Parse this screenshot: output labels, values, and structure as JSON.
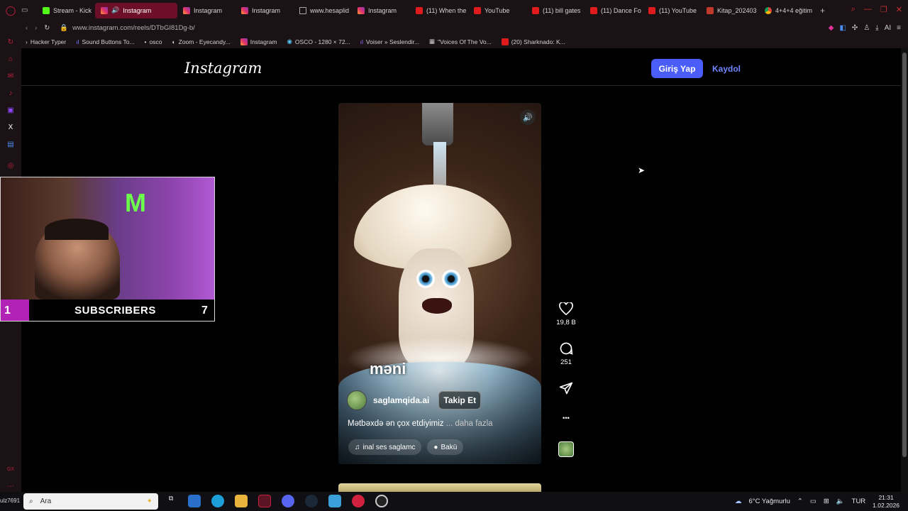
{
  "browser": {
    "tabs": [
      {
        "label": "Stream - Kick",
        "icon": "kick-icon"
      },
      {
        "label": "Instagram",
        "icon": "instagram-icon",
        "active": true
      },
      {
        "label": "Instagram",
        "icon": "instagram-icon"
      },
      {
        "label": "Instagram",
        "icon": "instagram-icon"
      },
      {
        "label": "www.hesaplid",
        "icon": "page-icon"
      },
      {
        "label": "Instagram",
        "icon": "instagram-icon"
      },
      {
        "label": "(11) When the",
        "icon": "youtube-icon"
      },
      {
        "label": "YouTube",
        "icon": "youtube-icon"
      },
      {
        "label": "(11) bill gates",
        "icon": "youtube-icon"
      },
      {
        "label": "(11) Dance Fo",
        "icon": "youtube-icon"
      },
      {
        "label": "(11) YouTube",
        "icon": "youtube-icon"
      },
      {
        "label": "Kitap_202403",
        "icon": "book-icon"
      },
      {
        "label": "4+4+4 eğitim",
        "icon": "google-icon"
      }
    ],
    "url": "www.instagram.com/reels/DTbGI81Dg-b/",
    "bookmarks": [
      "Hacker Typer",
      "Sound Buttons To...",
      "osco",
      "Zoom - Eyecandy...",
      "Instagram",
      "OSCO - 1280 × 72...",
      "Voiser » Seslendir...",
      "\"Voices Of The Vo...",
      "(20) Sharknado: K..."
    ],
    "ai_label": "AI"
  },
  "instagram": {
    "logo": "Instagram",
    "login_label": "Giriş Yap",
    "signup_label": "Kaydol",
    "reel": {
      "overlay_word": "məni",
      "username": "saglamqida.ai",
      "follow_label": "Takip Et",
      "caption": "Mətbəxdə ən çox etdiyimiz",
      "more_label": "... daha fazla",
      "audio_label": "inal ses   saglamc",
      "location_label": "Bakü"
    },
    "actions": {
      "likes": "19,8 B",
      "comments": "251"
    }
  },
  "webcam": {
    "subscribers_label": "SUBSCRIBERS",
    "left_count": "1",
    "right_count": "7"
  },
  "taskbar": {
    "search_placeholder": "Ara",
    "left_overlay": "ulz7691",
    "weather": "6°C  Yağmurlu",
    "language": "TUR",
    "time": "21:31",
    "date": "1.02.2026"
  }
}
